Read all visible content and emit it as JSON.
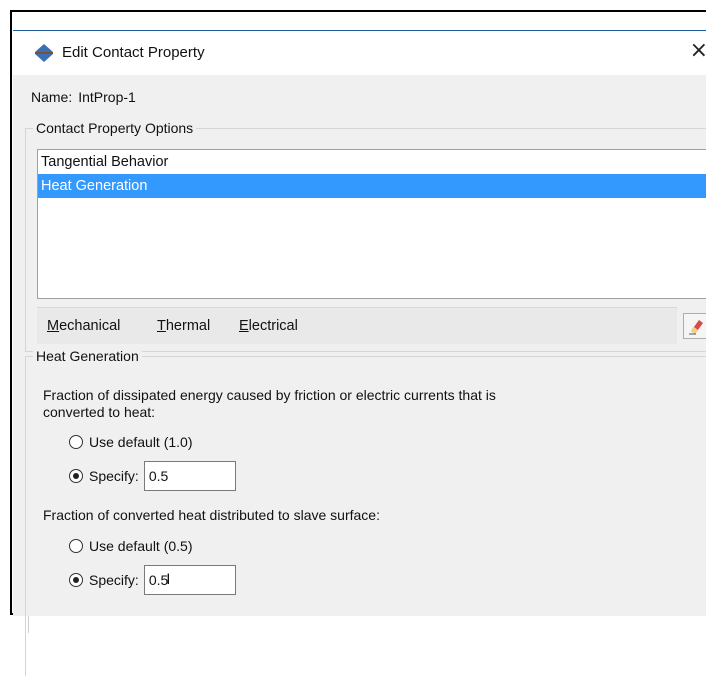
{
  "dialog": {
    "title": "Edit Contact Property",
    "close_glyph": "×",
    "name_label": "Name:",
    "name_value": "IntProp-1"
  },
  "options": {
    "legend": "Contact Property Options",
    "items": [
      {
        "label": "Tangential Behavior",
        "selected": false
      },
      {
        "label": "Heat Generation",
        "selected": true
      }
    ],
    "menus": [
      {
        "mnemonic": "M",
        "rest": "echanical"
      },
      {
        "mnemonic": "T",
        "rest": "hermal"
      },
      {
        "mnemonic": "E",
        "rest": "lectrical"
      }
    ],
    "edit_icon": "eraser-icon"
  },
  "heat": {
    "legend": "Heat Generation",
    "fraction1_desc": "Fraction of dissipated energy caused by friction or electric currents that is converted to heat:",
    "fraction1_default_label": "Use default (1.0)",
    "fraction1_specify_label": "Specify:",
    "fraction1_value": "0.5",
    "fraction2_desc": "Fraction of converted heat distributed to slave surface:",
    "fraction2_default_label": "Use default (0.5)",
    "fraction2_specify_label": "Specify:",
    "fraction2_value": "0.5"
  },
  "colors": {
    "selection": "#3399ff",
    "dialog_bg": "#f0f0f0",
    "title_accent": "#1f5c99"
  }
}
